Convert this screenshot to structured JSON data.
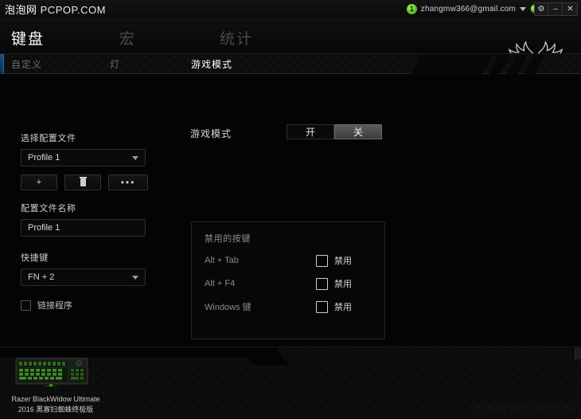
{
  "titlebar": {
    "watermark_cn": "泡泡网",
    "watermark_en": "PCPOP.COM",
    "notification_count": "1",
    "account_email": "zhangmw366@gmail.com",
    "caret_icon": "chevron-down-icon",
    "status_icon": "online-status-orb",
    "window_buttons": [
      {
        "name": "settings-button",
        "glyph": "⚙"
      },
      {
        "name": "minimize-button",
        "glyph": "–"
      },
      {
        "name": "close-button",
        "glyph": "✕"
      }
    ]
  },
  "tabs": {
    "main": [
      {
        "label": "键盘",
        "active": true
      },
      {
        "label": "宏",
        "active": false
      },
      {
        "label": "统计",
        "active": false
      }
    ],
    "sub": [
      {
        "label": "自定义",
        "active": false
      },
      {
        "label": "灯",
        "active": false
      },
      {
        "label": "游戏模式",
        "active": true
      }
    ],
    "logo_icon": "razer-logo-icon"
  },
  "profile": {
    "select_label": "选择配置文件",
    "selected_profile": "Profile 1",
    "buttons": [
      {
        "name": "add-profile-button",
        "label": "+"
      },
      {
        "name": "delete-profile-button",
        "label": ""
      },
      {
        "name": "more-options-button",
        "label": "•••"
      }
    ],
    "name_label": "配置文件名称",
    "name_value": "Profile 1",
    "shortcut_label": "快捷键",
    "shortcut_value": "FN + 2",
    "link_program_label": "链接程序",
    "link_program_checked": false
  },
  "game_mode": {
    "title": "游戏模式",
    "toggle_on_label": "开",
    "toggle_off_label": "关",
    "selected": "关",
    "panel_title": "禁用的按键",
    "rows": [
      {
        "key": "Alt + Tab",
        "checkbox_label": "禁用",
        "checked": false
      },
      {
        "key": "Alt + F4",
        "checkbox_label": "禁用",
        "checked": false
      },
      {
        "key": "Windows 键",
        "checkbox_label": "禁用",
        "checked": false
      }
    ]
  },
  "footer": {
    "device_icon": "keyboard-device-image",
    "device_name_line1": "Razer BlackWidow Ultimate",
    "device_name_line2": "2016 黑寡妇蜘蛛终极版",
    "watermark_cn": "泡泡网",
    "watermark_en": "PCPOP.COM"
  },
  "colors": {
    "accent_green": "#6dbf2f",
    "accent_blue": "#1d4e86",
    "background": "#040404",
    "text_primary": "#ffffff",
    "text_muted": "#6d6d6d"
  }
}
